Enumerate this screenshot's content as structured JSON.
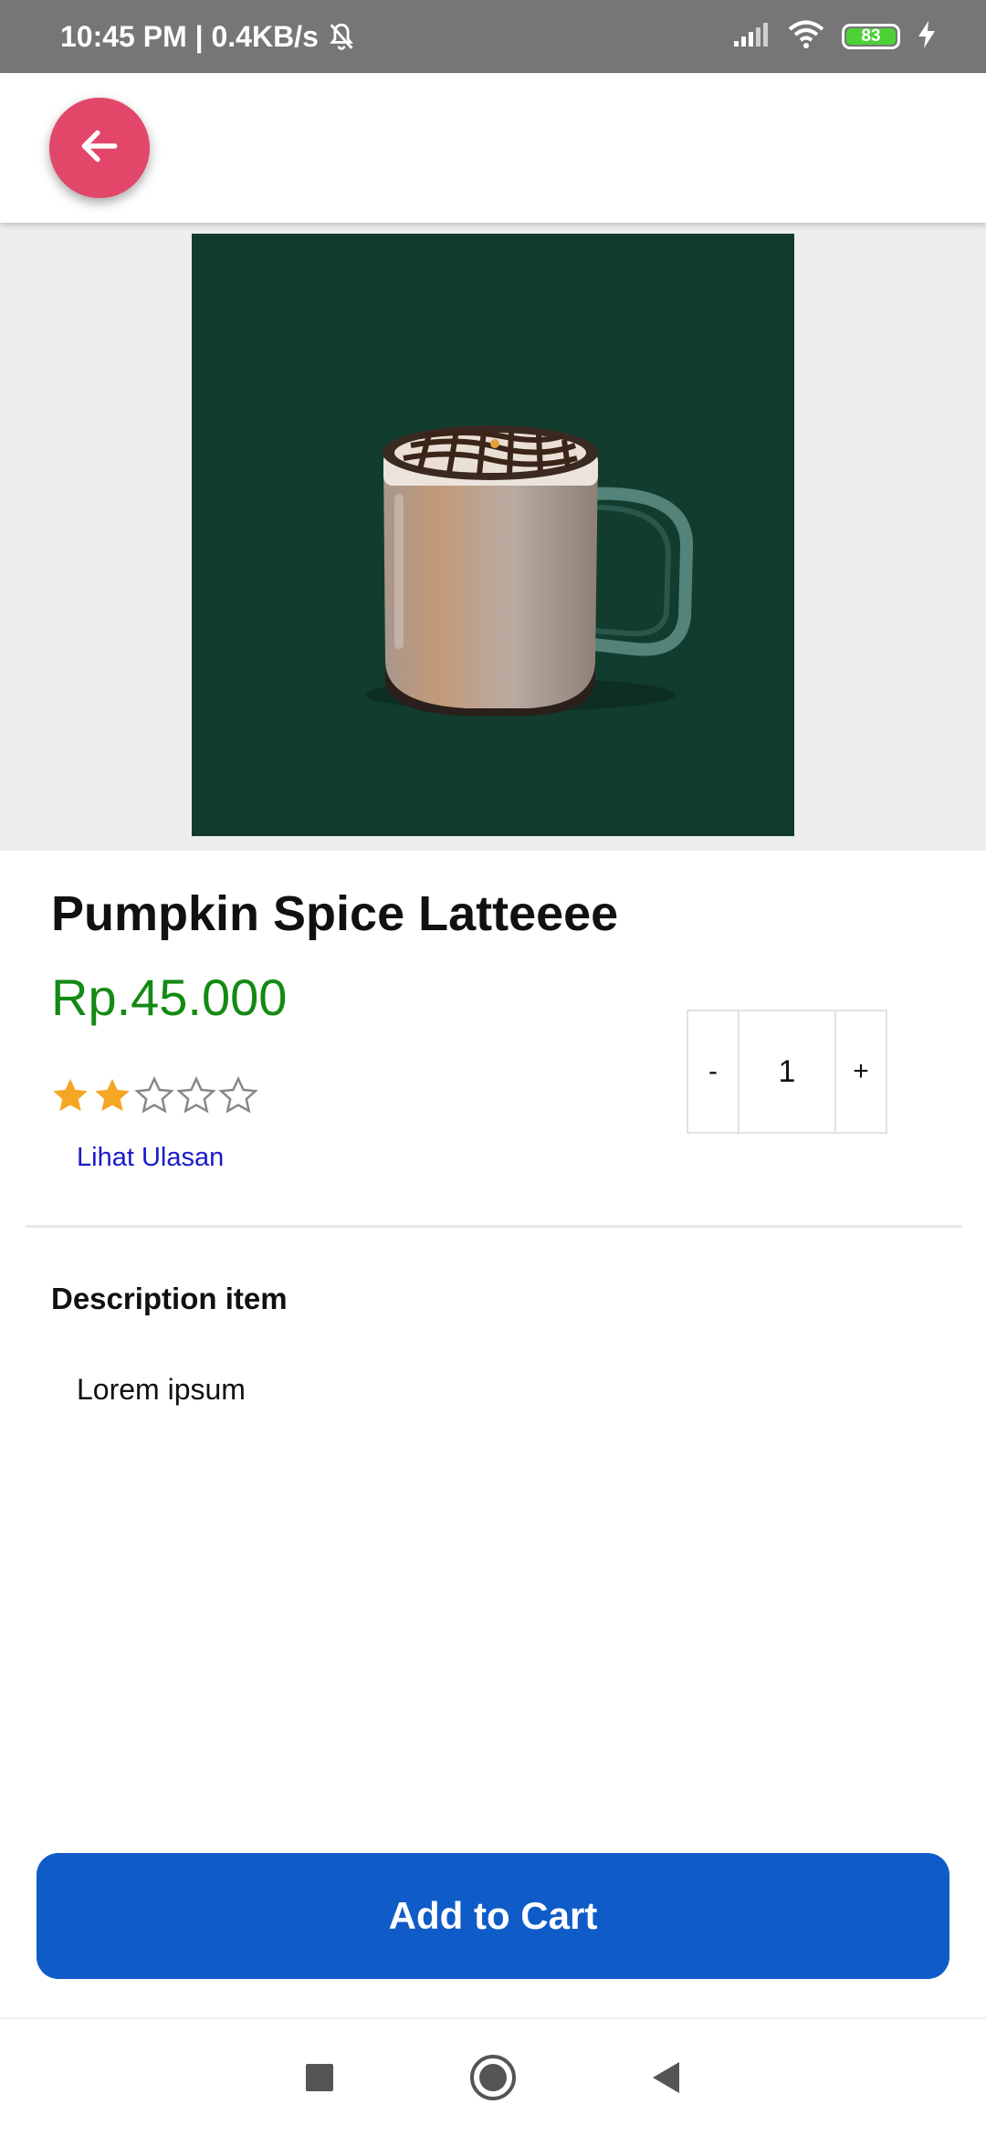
{
  "status_bar": {
    "time_speed": "10:45 PM | 0.4KB/s",
    "battery_level": "83",
    "battery_color": "#4cd137"
  },
  "app_bar": {
    "back_icon": "arrow-left-icon",
    "accent_color": "#e2476a"
  },
  "product": {
    "image_icon": "pumpkin-spice-latte-mug",
    "name": "Pumpkin Spice Latteeee",
    "price": "Rp.45.000",
    "price_color": "#138a13",
    "rating": 2,
    "rating_max": 5,
    "review_link": "Lihat Ulasan"
  },
  "quantity": {
    "minus_label": "-",
    "value": "1",
    "plus_label": "+"
  },
  "description": {
    "heading": "Description item",
    "text": "Lorem ipsum"
  },
  "cart": {
    "button_label": "Add to Cart",
    "button_color": "#0f5cc8"
  },
  "nav_bar": {
    "icons": [
      "recents-square-icon",
      "home-circle-icon",
      "back-triangle-icon"
    ]
  }
}
